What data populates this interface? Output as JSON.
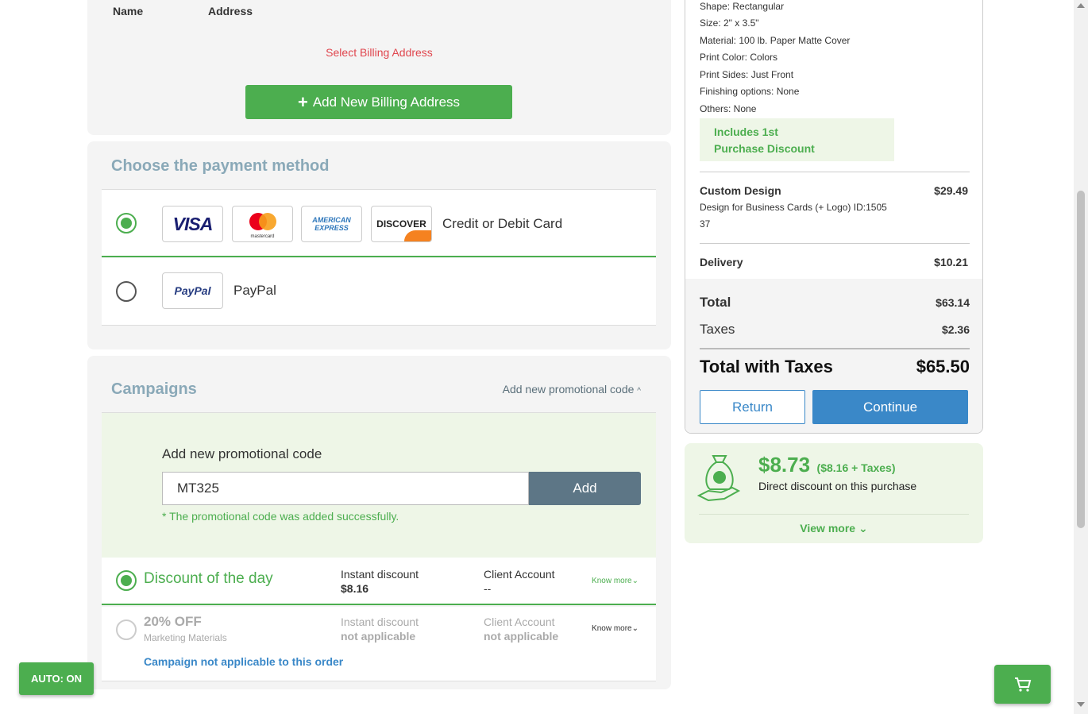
{
  "billing": {
    "col_name": "Name",
    "col_address": "Address",
    "select_label": "Select Billing Address",
    "add_button": "Add New Billing Address"
  },
  "payment": {
    "title": "Choose the payment method",
    "options": [
      {
        "label": "Credit or Debit Card",
        "selected": true,
        "logos": [
          "VISA",
          "mastercard",
          "AMERICAN EXPRESS",
          "DISCOVER"
        ]
      },
      {
        "label": "PayPal",
        "selected": false,
        "logos": [
          "PayPal"
        ]
      }
    ]
  },
  "campaigns": {
    "title": "Campaigns",
    "toggle_label": "Add new promotional code",
    "promo_title": "Add new promotional code",
    "promo_value": "MT325",
    "add_button": "Add",
    "success_msg": "* The promotional code was added successfully.",
    "rows": [
      {
        "name": "Discount of the day",
        "sub": "",
        "instant_label": "Instant discount",
        "instant_value": "$8.16",
        "client_label": "Client Account",
        "client_value": "--",
        "know_more": "Know more",
        "selected": true
      },
      {
        "name": "20% OFF",
        "sub": "Marketing Materials",
        "instant_label": "Instant discount",
        "instant_value": "not applicable",
        "client_label": "Client Account",
        "client_value": "not applicable",
        "know_more": "Know more",
        "selected": false,
        "note": "Campaign not applicable to this order"
      }
    ]
  },
  "summary": {
    "specs": [
      "Shape: Rectangular",
      "Size: 2\" x 3.5\"",
      "Material: 100 lb. Paper Matte Cover",
      "Print Color: Colors",
      "Print Sides: Just Front",
      "Finishing options: None",
      "Others: None"
    ],
    "discount_badge_1": "Includes 1st",
    "discount_badge_2": "Purchase Discount",
    "custom_design_label": "Custom Design",
    "custom_design_value": "$29.49",
    "custom_design_desc_1": "Design for Business Cards (+ Logo) ID:1505",
    "custom_design_desc_2": "37",
    "delivery_label": "Delivery",
    "delivery_value": "$10.21",
    "total_label": "Total",
    "total_value": "$63.14",
    "taxes_label": "Taxes",
    "taxes_value": "$2.36",
    "total_taxes_label": "Total with Taxes",
    "total_taxes_value": "$65.50",
    "return_button": "Return",
    "continue_button": "Continue"
  },
  "discount_card": {
    "amount": "$8.73",
    "amount_detail": "($8.16 + Taxes)",
    "description": "Direct discount on this purchase",
    "view_more": "View more"
  },
  "auto_button": "AUTO: ON",
  "colors": {
    "accent_green": "#4cae4f",
    "accent_blue": "#3a88c8",
    "title_gray": "#8aa9b8",
    "error_red": "#e0464e"
  }
}
